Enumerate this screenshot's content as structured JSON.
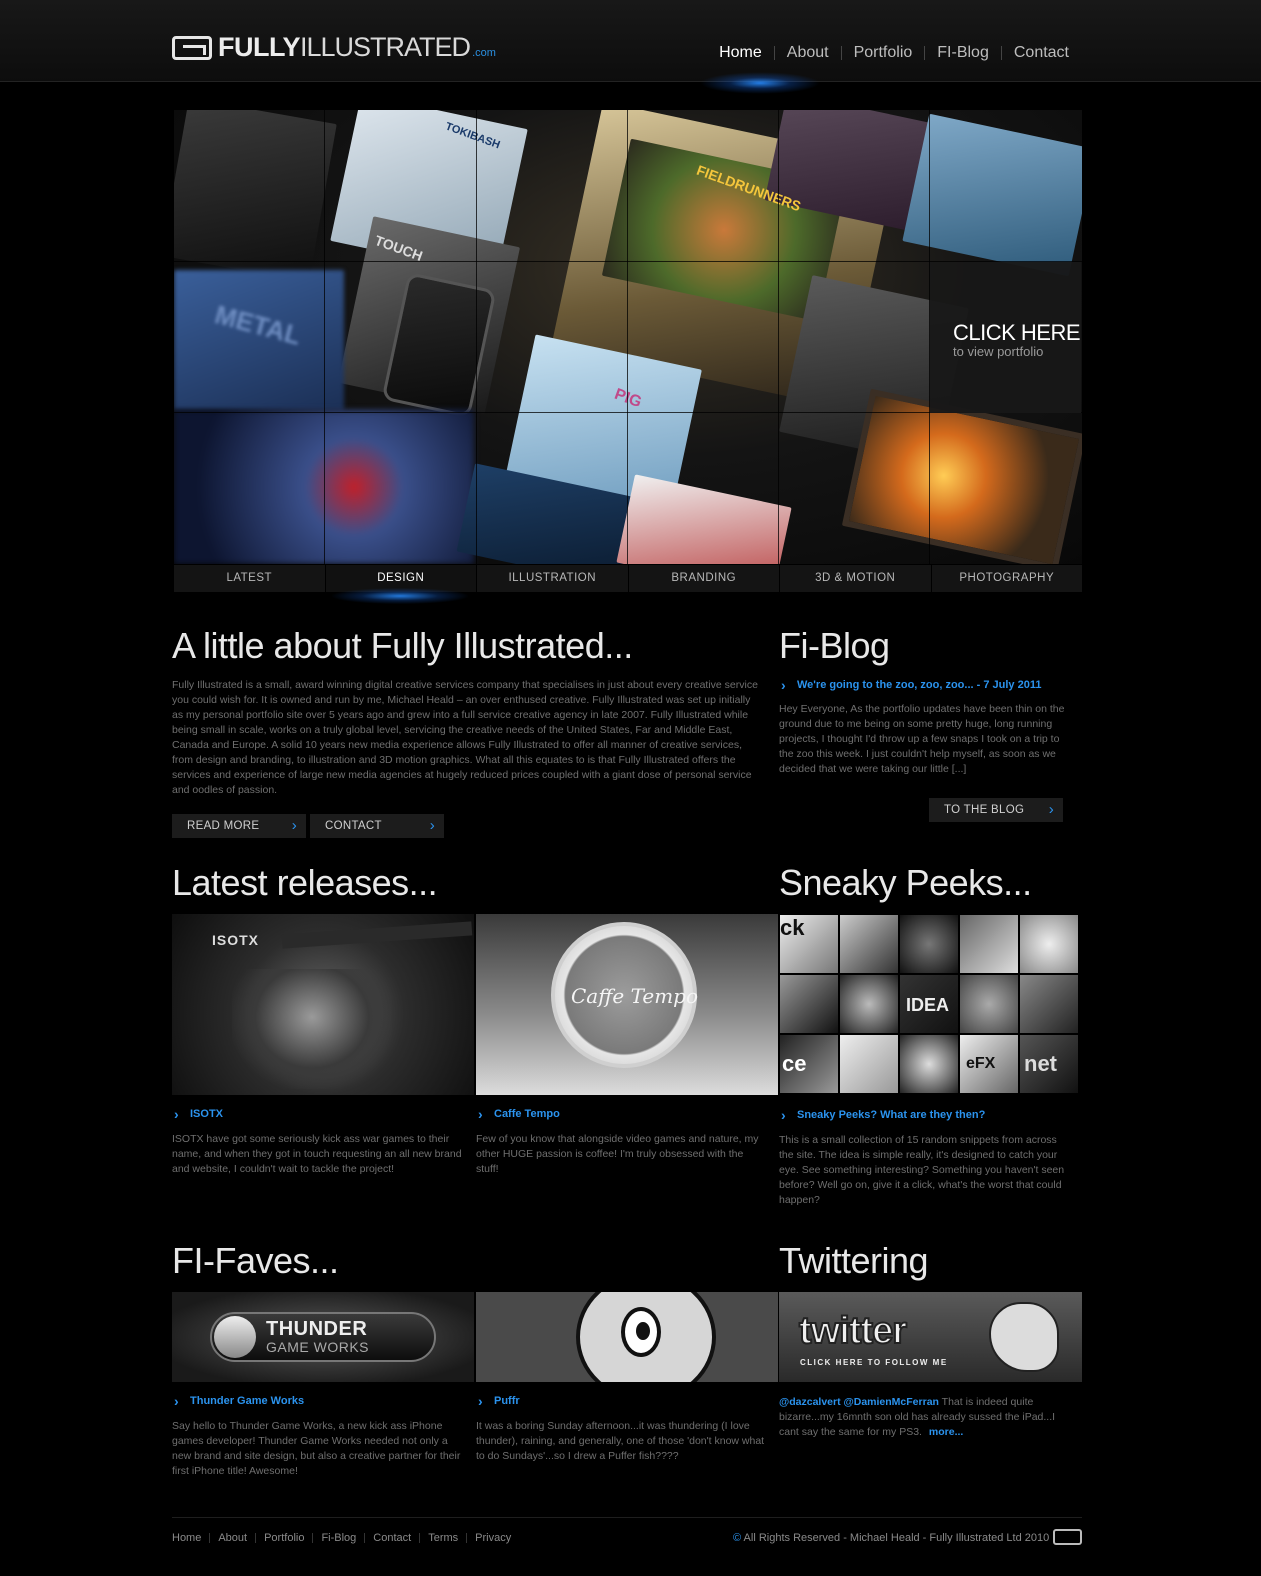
{
  "header": {
    "logo_bold": "FULLY",
    "logo_light": "ILLUSTRATED",
    "logo_suffix": ".com",
    "nav": [
      "Home",
      "About",
      "Portfolio",
      "FI-Blog",
      "Contact"
    ]
  },
  "hero": {
    "cta_title": "CLICK HERE",
    "cta_subtitle": "to view portfolio",
    "shot_words": [
      "FIELDRUNNERS",
      "TOUCH",
      "TOKIBASH",
      "PIG",
      "METAL"
    ],
    "tabs": [
      "LATEST",
      "DESIGN",
      "ILLUSTRATION",
      "BRANDING",
      "3D & MOTION",
      "PHOTOGRAPHY"
    ],
    "active_tab": "DESIGN"
  },
  "about": {
    "title": "A little about Fully Illustrated...",
    "text": "Fully Illustrated is a small, award winning digital creative services company that specialises in just about every creative service you could wish for. It is owned and run by me, Michael Heald – an over enthused creative. Fully Illustrated was set up initially as my personal portfolio site over 5 years ago and grew into a full service creative agency in late 2007. Fully Illustrated while being small in scale, works on a truly global level, servicing the creative needs of the United States, Far and Middle East, Canada and Europe. A solid 10 years new media experience allows Fully Illustrated to offer all manner of creative services, from design and branding, to illustration and 3D motion graphics. What all this equates to is that Fully Illustrated offers the services and experience of large new media agencies at hugely reduced prices coupled with a giant dose of personal service and oodles of passion.",
    "read_more": "READ MORE",
    "contact": "CONTACT"
  },
  "blog": {
    "title": "Fi-Blog",
    "post_link": "We're going to the zoo, zoo, zoo... - 7 July 2011",
    "post_text": "Hey Everyone, As the portfolio updates have been thin on the ground due to me being on some pretty huge, long running projects, I thought I'd throw up a few snaps I took on a trip to the zoo this week.  I just couldn't help myself, as soon as we decided that we were taking our little [...]",
    "button": "TO THE BLOG"
  },
  "latest": {
    "title": "Latest releases...",
    "items": [
      {
        "thumb_text": "ISOTX",
        "link": "ISOTX",
        "text": "ISOTX have got some seriously kick ass war games to their name, and when they got in touch requesting an all new brand and website, I couldn't wait to tackle the project!"
      },
      {
        "thumb_text": "Caffe Tempo",
        "link": "Caffe Tempo",
        "text": "Few of you know that alongside video games and nature, my other HUGE passion is coffee! I'm truly obsessed with the stuff!"
      }
    ]
  },
  "peeks": {
    "title": "Sneaky Peeks...",
    "link": "Sneaky Peeks? What are they then?",
    "text": "This is a small collection of 15 random snippets from across the site. The idea is simple really, it's designed to catch your eye. See something interesting? Something you haven't seen before? Well go on, give it a click, what's the worst that could happen?",
    "tiles": [
      "ck",
      "",
      "",
      "",
      "",
      "",
      "",
      "IDEA",
      "",
      "",
      "ce",
      "",
      "",
      "eFX",
      "net"
    ]
  },
  "faves": {
    "title": "FI-Faves...",
    "items": [
      {
        "thumb_title": "THUNDER",
        "thumb_sub": "GAME WORKS",
        "link": "Thunder Game Works",
        "text": "Say hello to Thunder Game Works, a new kick ass iPhone games developer! Thunder Game Works needed not only a new brand and site design, but also a creative partner for their first iPhone title! Awesome!"
      },
      {
        "link": "Puffr",
        "text": "It was a boring Sunday afternoon...it was thundering (I love thunder), raining, and generally, one of those 'don't know what to do Sundays'...so I drew a Puffer fish????"
      }
    ]
  },
  "twitter": {
    "title": "Twittering",
    "thumb_title": "twitter",
    "thumb_sub": "CLICK HERE TO FOLLOW ME",
    "handles": "@dazcalvert @DamienMcFerran",
    "text": " That is indeed quite bizarre...my 16mnth son old has already sussed the iPad...I cant say the same for my PS3.",
    "more": "more..."
  },
  "footer": {
    "nav": [
      "Home",
      "About",
      "Portfolio",
      "Fi-Blog",
      "Contact",
      "Terms",
      "Privacy"
    ],
    "copyright_symbol": "©",
    "copyright": " All Rights Reserved - Michael Heald - Fully Illustrated Ltd 2010"
  },
  "colors": {
    "accent": "#2b93ee",
    "background": "#000000"
  }
}
